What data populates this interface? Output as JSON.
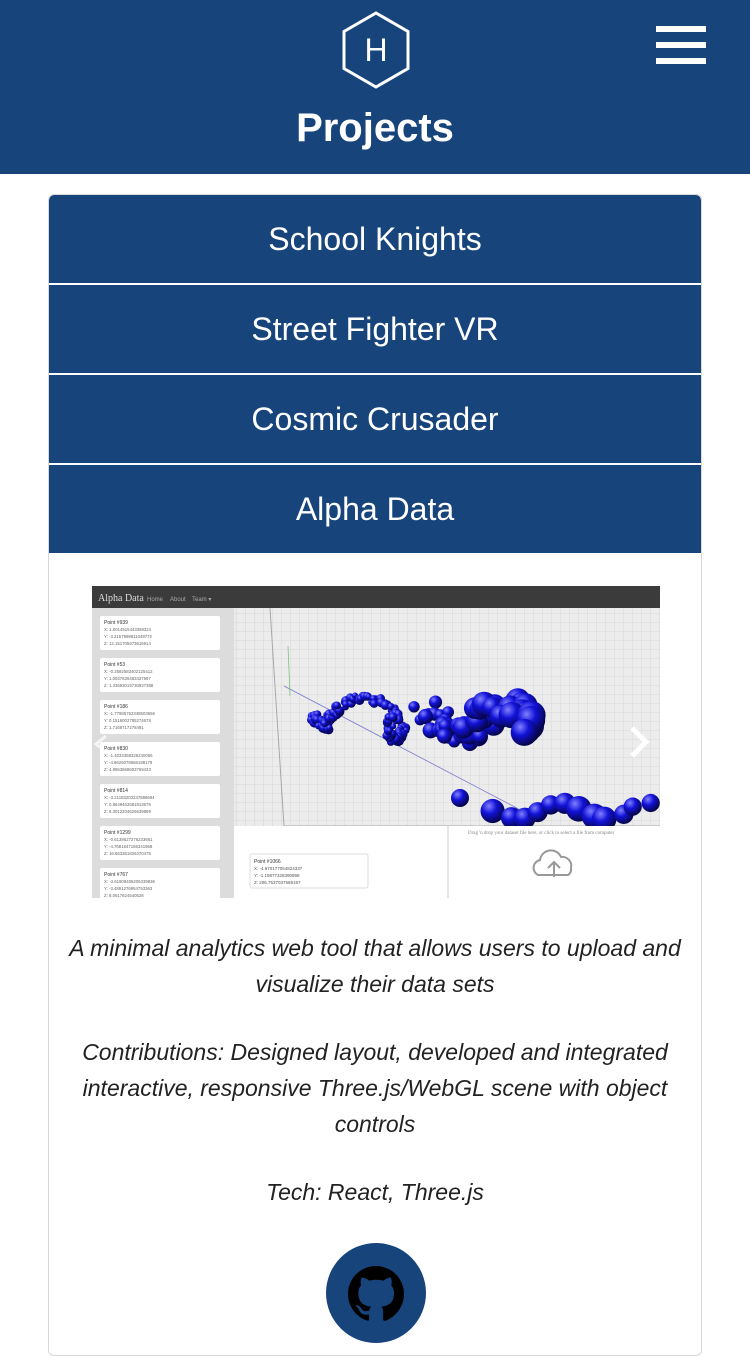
{
  "header": {
    "logo_letter": "H",
    "title": "Projects",
    "menu_icon": "hamburger-menu-icon"
  },
  "projects": [
    {
      "label": "School Knights"
    },
    {
      "label": "Street Fighter VR"
    },
    {
      "label": "Cosmic Crusader"
    },
    {
      "label": "Alpha Data"
    }
  ],
  "screenshot": {
    "brand": "Alpha Data",
    "nav": [
      "Home",
      "About",
      "Team ▾"
    ],
    "points": [
      {
        "name": "Point #939",
        "x": "X: 1.0014515443368324",
        "y": "Y: -3.2157998811049772",
        "z": "Z: 12.151705673616914"
      },
      {
        "name": "Point #53",
        "x": "X: -0.2592583402125412",
        "y": "Y: 1.0047636483427997",
        "z": "Z: 1.33593015730937388"
      },
      {
        "name": "Point #186",
        "x": "X: -1.77985762348503556",
        "y": "Y: 0.1516002785274678",
        "z": "Z: 1.7168717278491"
      },
      {
        "name": "Point #830",
        "x": "X: -1.4033358326240066",
        "y": "Y: -4.8626078656188179",
        "z": "Z: 4.8963668603769433"
      },
      {
        "name": "Point #814",
        "x": "X: -3.21183203247888694",
        "y": "Y: 0.8649462681913676",
        "z": "Z: 8.3012204626639899"
      },
      {
        "name": "Point #1299",
        "x": "X: -0.6138627276233661",
        "y": "Y: -4.7681647165341968",
        "z": "Z: 16.663361826370475"
      },
      {
        "name": "Point #767",
        "x": "X: -3.61909406206339836",
        "y": "Y: -3.4891276954753363",
        "z": "Z: 8.0617624540528"
      }
    ],
    "tooltip": {
      "name": "Point #1066",
      "x": "X: -4.670177054824337",
      "y": "Y: -1.19877328390898",
      "z": "Z: 206.7537037569187"
    },
    "dropzone_text": "Drag 'n drop your dataset file here, or click to select a file from computer"
  },
  "details": {
    "description": "A minimal analytics web tool that allows users to upload and visualize their data sets",
    "contributions": "Contributions: Designed layout, developed and integrated interactive, responsive Three.js/WebGL scene with object controls",
    "tech": "Tech: React, Three.js"
  },
  "github_icon": "github-icon",
  "colors": {
    "primary": "#18447c",
    "sphere": "#1010d0"
  }
}
